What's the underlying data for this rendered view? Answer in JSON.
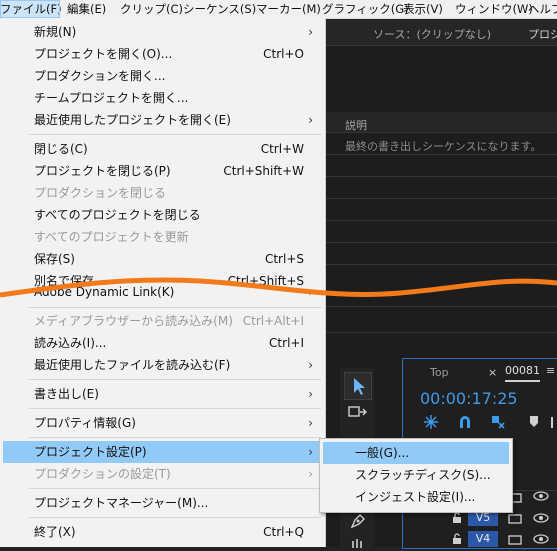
{
  "menubar": {
    "items": [
      {
        "label": "ファイル(F)",
        "active": true
      },
      {
        "label": "編集(E)"
      },
      {
        "label": "クリップ(C)"
      },
      {
        "label": "シーケンス(S)"
      },
      {
        "label": "マーカー(M)"
      },
      {
        "label": "グラフィック(G)"
      },
      {
        "label": "表示(V)"
      },
      {
        "label": "ウィンドウ(W)"
      },
      {
        "label": "ヘルプ"
      }
    ]
  },
  "background": {
    "source_label": "ソース：(クリップなし)",
    "project_tab": "プロジ",
    "description_header": "説明",
    "description_text": "最終の書き出しシーケンスになります。",
    "timeline_label": "Top",
    "timeline_name": "00081",
    "timecode": "00:00:17:25",
    "tracks": [
      "V5",
      "V4"
    ]
  },
  "file_menu": {
    "items": [
      {
        "label": "新規(N)",
        "submenu": true
      },
      {
        "label": "プロジェクトを開く(O)...",
        "shortcut": "Ctrl+O"
      },
      {
        "label": "プロダクションを開く..."
      },
      {
        "label": "チームプロジェクトを開く..."
      },
      {
        "label": "最近使用したプロジェクトを開く(E)",
        "submenu": true
      },
      {
        "label": "閉じる(C)",
        "shortcut": "Ctrl+W"
      },
      {
        "label": "プロジェクトを閉じる(P)",
        "shortcut": "Ctrl+Shift+W"
      },
      {
        "label": "プロダクションを閉じる",
        "disabled": true
      },
      {
        "label": "すべてのプロジェクトを閉じる"
      },
      {
        "label": "すべてのプロジェクトを更新",
        "disabled": true
      },
      {
        "label": "保存(S)",
        "shortcut": "Ctrl+S"
      },
      {
        "label": "別名で保存...",
        "shortcut": "Ctrl+Shift+S"
      },
      {
        "label": "Adobe Dynamic Link(K)",
        "submenu": true
      },
      {
        "label": "メディアブラウザーから読み込み(M)",
        "shortcut": "Ctrl+Alt+I",
        "disabled": true
      },
      {
        "label": "読み込み(I)...",
        "shortcut": "Ctrl+I"
      },
      {
        "label": "最近使用したファイルを読み込む(F)",
        "submenu": true
      },
      {
        "label": "書き出し(E)",
        "submenu": true
      },
      {
        "label": "プロパティ情報(G)",
        "submenu": true
      },
      {
        "label": "プロジェクト設定(P)",
        "submenu": true,
        "highlight": true
      },
      {
        "label": "プロダクションの設定(T)",
        "submenu": true,
        "disabled": true
      },
      {
        "label": "プロジェクトマネージャー(M)..."
      },
      {
        "label": "終了(X)",
        "shortcut": "Ctrl+Q"
      }
    ]
  },
  "submenu": {
    "items": [
      {
        "label": "一般(G)...",
        "highlight": true
      },
      {
        "label": "スクラッチディスク(S)..."
      },
      {
        "label": "インジェスト設定(I)..."
      }
    ]
  },
  "colors": {
    "highlight": "#91c9f7",
    "wave": "#f27a1a",
    "timecode": "#3d9be9",
    "track_label_bg": "#2b58a8"
  },
  "icons": [
    "chevron-right-icon",
    "selection-tool-icon",
    "magnet-icon",
    "eye-icon",
    "lock-icon",
    "pen-tool-icon",
    "wrench-icon"
  ]
}
